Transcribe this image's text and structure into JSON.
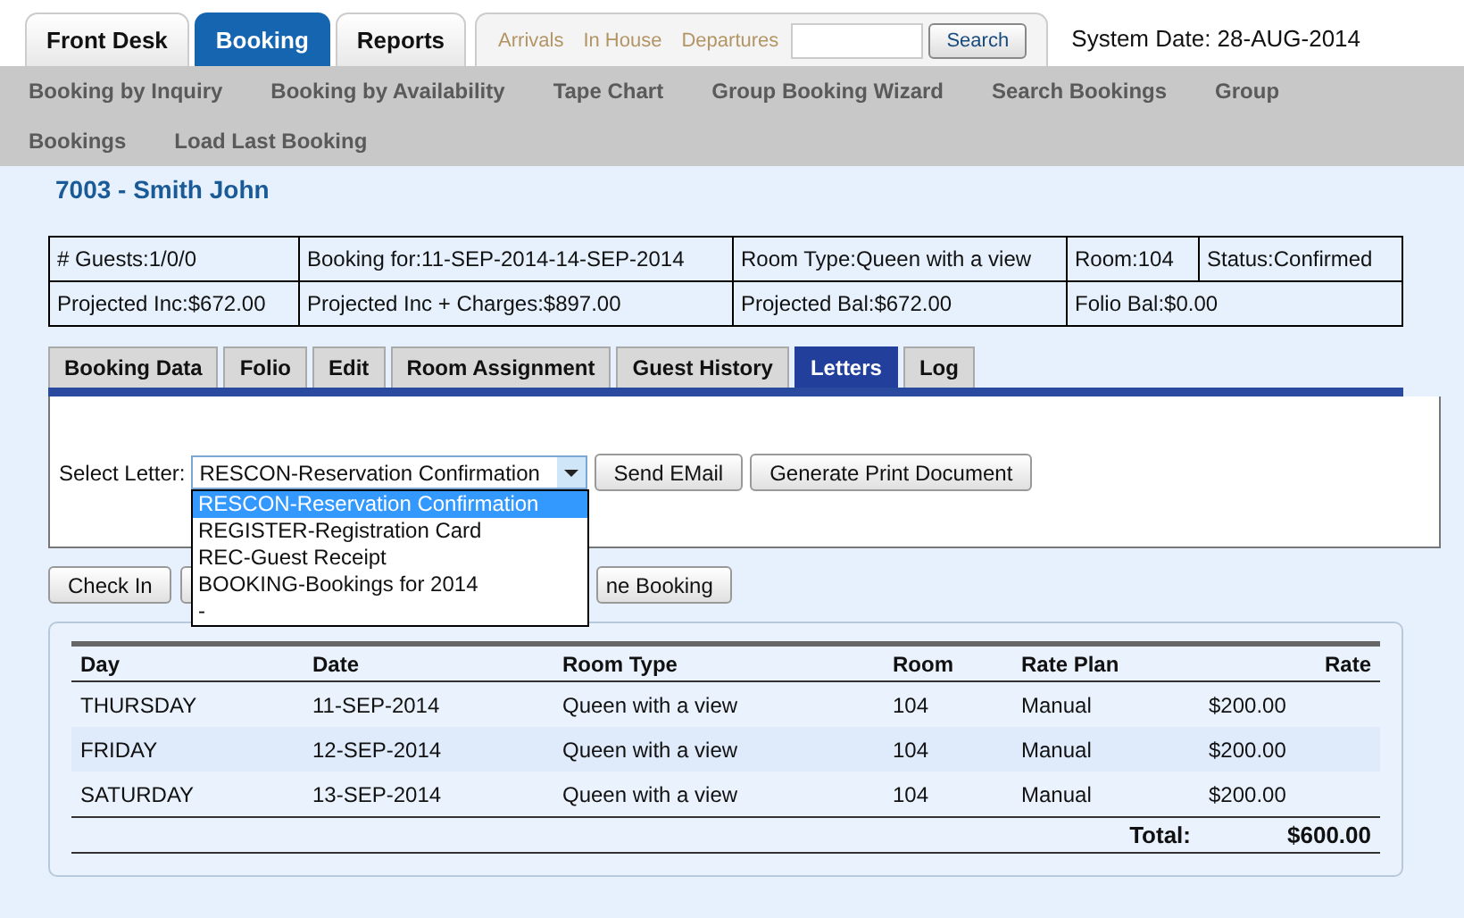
{
  "nav_tabs": [
    {
      "label": "Front Desk",
      "selected": false
    },
    {
      "label": "Booking",
      "selected": true
    },
    {
      "label": "Reports",
      "selected": false
    }
  ],
  "quick_links": [
    "Arrivals",
    "In House",
    "Departures"
  ],
  "search": {
    "button": "Search"
  },
  "system_date": "System Date: 28-AUG-2014",
  "menu": [
    "Booking by Inquiry",
    "Booking by Availability",
    "Tape Chart",
    "Group Booking Wizard",
    "Search Bookings",
    "Group",
    "Bookings",
    "Load Last Booking"
  ],
  "booking_title": "7003 - Smith John",
  "summary": [
    [
      "# Guests:1/0/0",
      "Booking for:11-SEP-2014-14-SEP-2014",
      "Room Type:Queen with a view",
      "Room:104",
      "Status:Confirmed"
    ],
    [
      "Projected Inc:$672.00",
      "Projected Inc + Charges:$897.00",
      "Projected Bal:$672.00",
      "Folio Bal:$0.00"
    ]
  ],
  "detail_tabs": [
    {
      "label": "Booking Data",
      "selected": false
    },
    {
      "label": "Folio",
      "selected": false
    },
    {
      "label": "Edit",
      "selected": false
    },
    {
      "label": "Room Assignment",
      "selected": false
    },
    {
      "label": "Guest History",
      "selected": false
    },
    {
      "label": "Letters",
      "selected": true
    },
    {
      "label": "Log",
      "selected": false
    }
  ],
  "letters": {
    "label": "Select Letter:",
    "value": "RESCON-Reservation Confirmation",
    "buttons": [
      "Send EMail",
      "Generate Print Document"
    ],
    "options": [
      {
        "label": "RESCON-Reservation Confirmation",
        "selected": true
      },
      {
        "label": "REGISTER-Registration Card",
        "selected": false
      },
      {
        "label": "REC-Guest Receipt",
        "selected": false
      },
      {
        "label": "BOOKING-Bookings for 2014",
        "selected": false
      },
      {
        "label": "-",
        "selected": false
      }
    ]
  },
  "actions": {
    "first": "Check In",
    "partial": "ne Booking"
  },
  "rates": {
    "columns": [
      "Day",
      "Date",
      "Room Type",
      "Room",
      "Rate Plan",
      "Rate"
    ],
    "rows": [
      [
        "THURSDAY",
        "11-SEP-2014",
        "Queen with a view",
        "104",
        "Manual",
        "$200.00"
      ],
      [
        "FRIDAY",
        "12-SEP-2014",
        "Queen with a view",
        "104",
        "Manual",
        "$200.00"
      ],
      [
        "SATURDAY",
        "13-SEP-2014",
        "Queen with a view",
        "104",
        "Manual",
        "$200.00"
      ]
    ],
    "total_label": "Total:",
    "total_value": "$600.00"
  }
}
